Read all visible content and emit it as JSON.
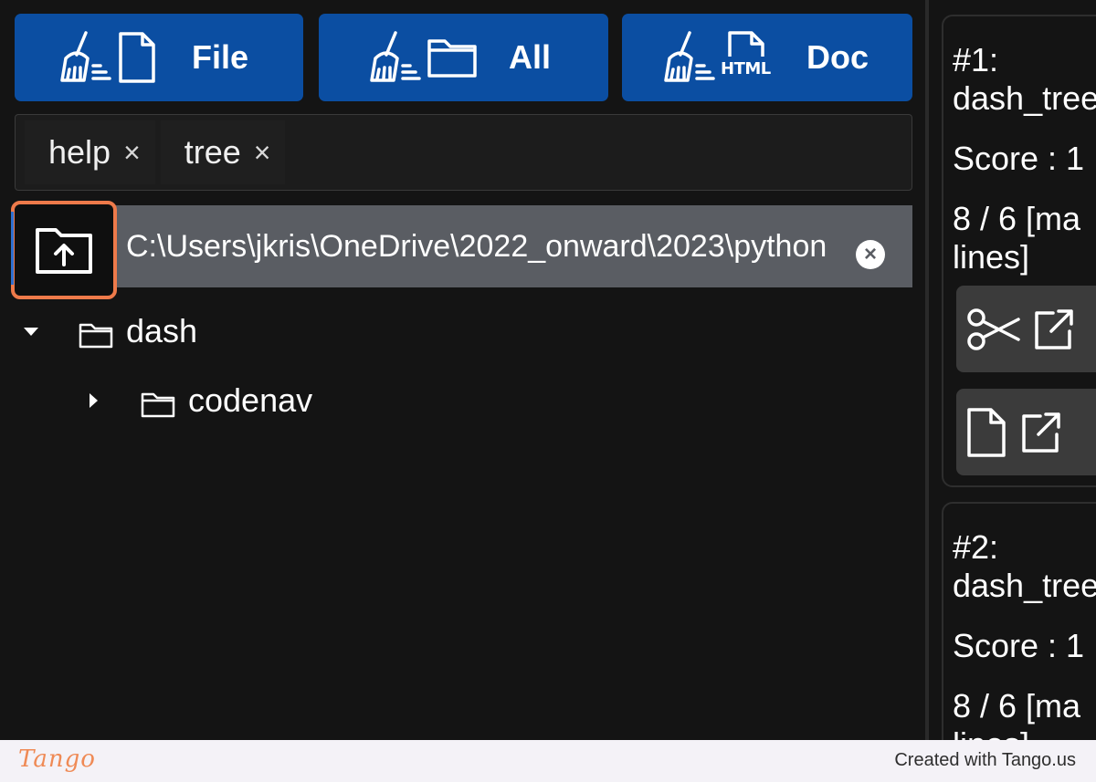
{
  "toolbar": {
    "file_label": "File",
    "all_label": "All",
    "doc_label": "Doc",
    "html_icon_text": "HTML"
  },
  "tags": [
    {
      "label": "help",
      "remove": "×"
    },
    {
      "label": "tree",
      "remove": "×"
    }
  ],
  "path": {
    "value": "C:\\Users\\jkris\\OneDrive\\2022_onward\\2023\\python",
    "clear": "×"
  },
  "tree": [
    {
      "label": "dash",
      "expanded": true
    },
    {
      "label": "codenav",
      "expanded": false
    }
  ],
  "results": [
    {
      "rank": "#1:",
      "name": "dash_tree",
      "score": "Score : 1",
      "lines_a": "8 / 6 [ma",
      "lines_b": "lines]"
    },
    {
      "rank": "#2:",
      "name": "dash_tree",
      "score": "Score : 1",
      "lines_a": "8 / 6 [ma",
      "lines_b": "lines]"
    }
  ],
  "footer": {
    "brand": "Tango",
    "credit": "Created with Tango.us"
  },
  "colors": {
    "background": "#141414",
    "button_blue": "#0b4ea2",
    "highlight": "#ee7a4a",
    "path_field": "#5a5d63"
  }
}
